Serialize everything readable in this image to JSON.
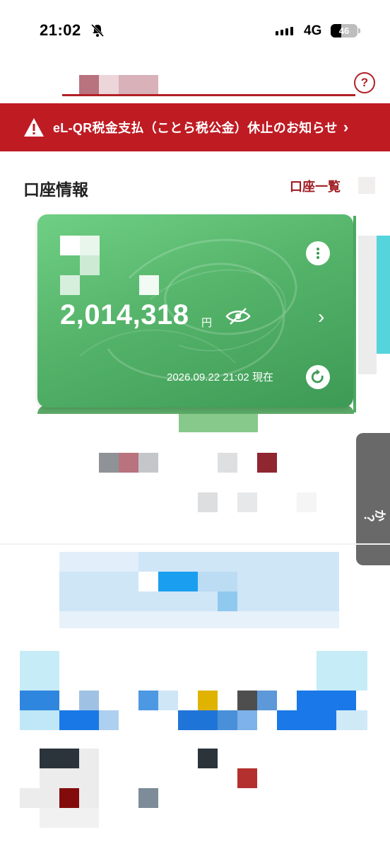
{
  "status_bar": {
    "time": "21:02",
    "network": "4G",
    "battery": "46"
  },
  "header": {
    "help_label": "?"
  },
  "banner": {
    "text": "eL-QR税金支払（ことら税公金）休止のお知らせ",
    "chevron": "›",
    "color": "#bf1b23"
  },
  "accounts": {
    "title": "口座情報",
    "list_link": "口座一覧",
    "card": {
      "balance": "2,014,318",
      "currency": "円",
      "timestamp": "2026.09.22 21:02 現在",
      "chevron": "›"
    }
  },
  "side_tab": {
    "label": "か？"
  },
  "icons": [
    "bell-slash-icon",
    "signal-icon",
    "battery-icon",
    "help-icon",
    "warning-icon",
    "chevron-right-icon",
    "more-vert-icon",
    "eye-off-icon",
    "refresh-icon"
  ]
}
